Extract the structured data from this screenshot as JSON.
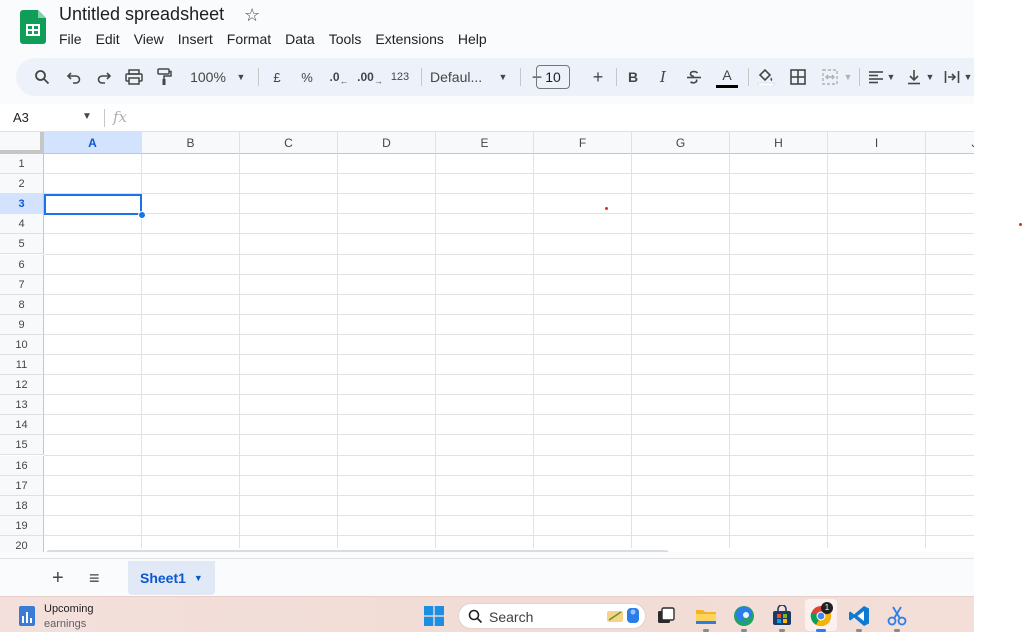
{
  "app": {
    "title": "Untitled spreadsheet",
    "menus": [
      "File",
      "Edit",
      "View",
      "Insert",
      "Format",
      "Data",
      "Tools",
      "Extensions",
      "Help"
    ]
  },
  "toolbar": {
    "zoom": "100%",
    "currency": "£",
    "percent": "%",
    "decrease_decimal": ".0",
    "increase_decimal": ".00",
    "format_123": "123",
    "font": "Defaul...",
    "font_size": "10",
    "bold": "B",
    "italic": "I",
    "text_color_letter": "A"
  },
  "formula_bar": {
    "name_box": "A3",
    "fx": "fx"
  },
  "grid": {
    "columns": [
      "A",
      "B",
      "C",
      "D",
      "E",
      "F",
      "G",
      "H",
      "I",
      "J"
    ],
    "rows": [
      "1",
      "2",
      "3",
      "4",
      "5",
      "6",
      "7",
      "8",
      "9",
      "10",
      "11",
      "12",
      "13",
      "14",
      "15",
      "16",
      "17",
      "18",
      "19",
      "20"
    ],
    "selected_cell": "A3"
  },
  "sheets": {
    "tabs": [
      {
        "label": "Sheet1"
      }
    ]
  },
  "taskbar": {
    "widget_title": "Upcoming",
    "widget_subtitle": "earnings",
    "search_label": "Search",
    "chrome_badge": "1"
  },
  "colors": {
    "accent": "#1a73e8",
    "sheets_green": "#0f9d58",
    "toolbar_bg": "#edf2fa",
    "selected_header": "#d3e3fd"
  }
}
